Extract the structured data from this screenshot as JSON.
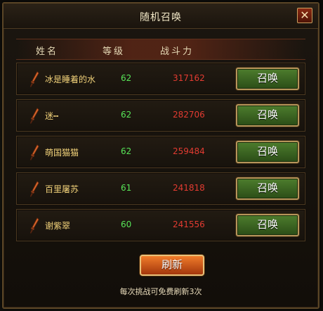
{
  "dialog": {
    "title": "随机召唤",
    "close_symbol": "✕"
  },
  "columns": {
    "name": "姓名",
    "level": "等级",
    "power": "战斗力"
  },
  "rows": [
    {
      "name": "冰是睡着的水",
      "level": "62",
      "power": "317162",
      "button": "召唤",
      "icon": "dagger-icon"
    },
    {
      "name": "迷┅",
      "level": "62",
      "power": "282706",
      "button": "召唤",
      "icon": "dagger-icon"
    },
    {
      "name": "萌国猫猫",
      "level": "62",
      "power": "259484",
      "button": "召唤",
      "icon": "dagger-icon"
    },
    {
      "name": "百里屠苏",
      "level": "61",
      "power": "241818",
      "button": "召唤",
      "icon": "dagger-icon"
    },
    {
      "name": "谢紫翠",
      "level": "60",
      "power": "241556",
      "button": "召唤",
      "icon": "dagger-icon"
    }
  ],
  "refresh_button": "刷新",
  "footnote": "每次挑战可免费刷新3次",
  "colors": {
    "name_text": "#f2d27a",
    "level_text": "#57e457",
    "power_text": "#e23b31",
    "summon_button": "#3d6a23",
    "refresh_button": "#d35a1a"
  }
}
